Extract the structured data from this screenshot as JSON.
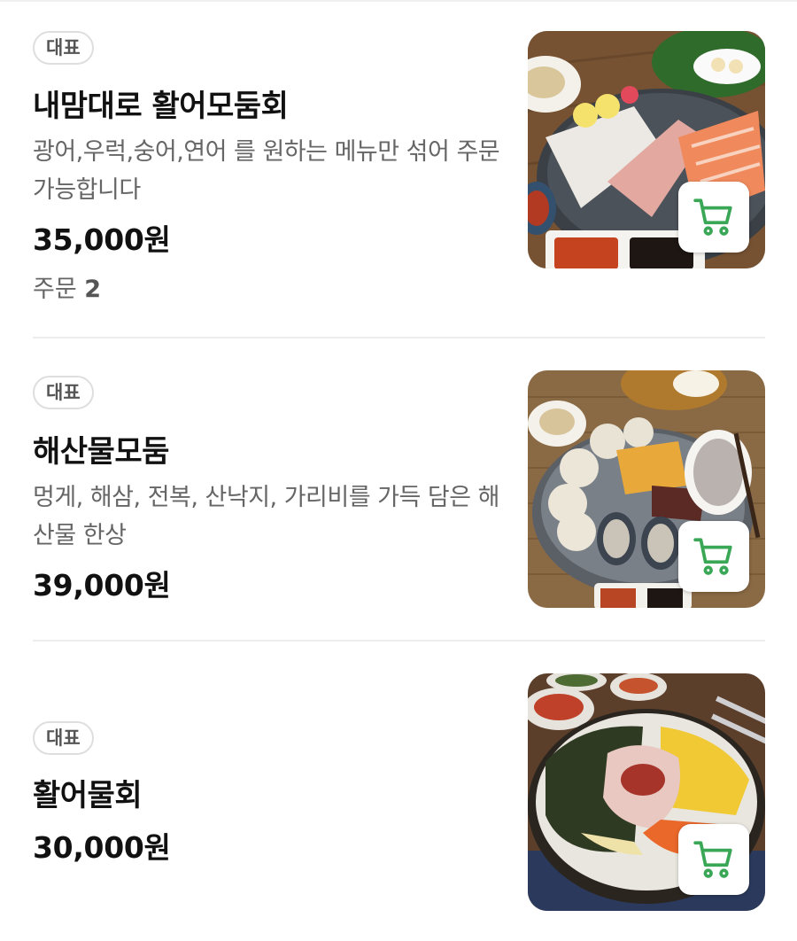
{
  "menu": {
    "items": [
      {
        "badge": "대표",
        "title": "내맘대로 활어모둠회",
        "description": "광어,우럭,숭어,연어 를 원하는 메뉴만 섞어 주문 가능합니다",
        "price": "35,000원",
        "orders_label": "주문",
        "orders_count": "2",
        "image": "sashimi-platter",
        "cart_icon": "cart-icon"
      },
      {
        "badge": "대표",
        "title": "해산물모둠",
        "description": "멍게, 해삼, 전복, 산낙지, 가리비를 가득 담은 해산물 한상",
        "price": "39,000원",
        "image": "seafood-platter",
        "cart_icon": "cart-icon"
      },
      {
        "badge": "대표",
        "title": "활어물회",
        "price": "30,000원",
        "image": "cold-raw-fish-soup",
        "cart_icon": "cart-icon"
      }
    ]
  },
  "colors": {
    "accent_green": "#3aa757",
    "divider": "#ececec"
  }
}
